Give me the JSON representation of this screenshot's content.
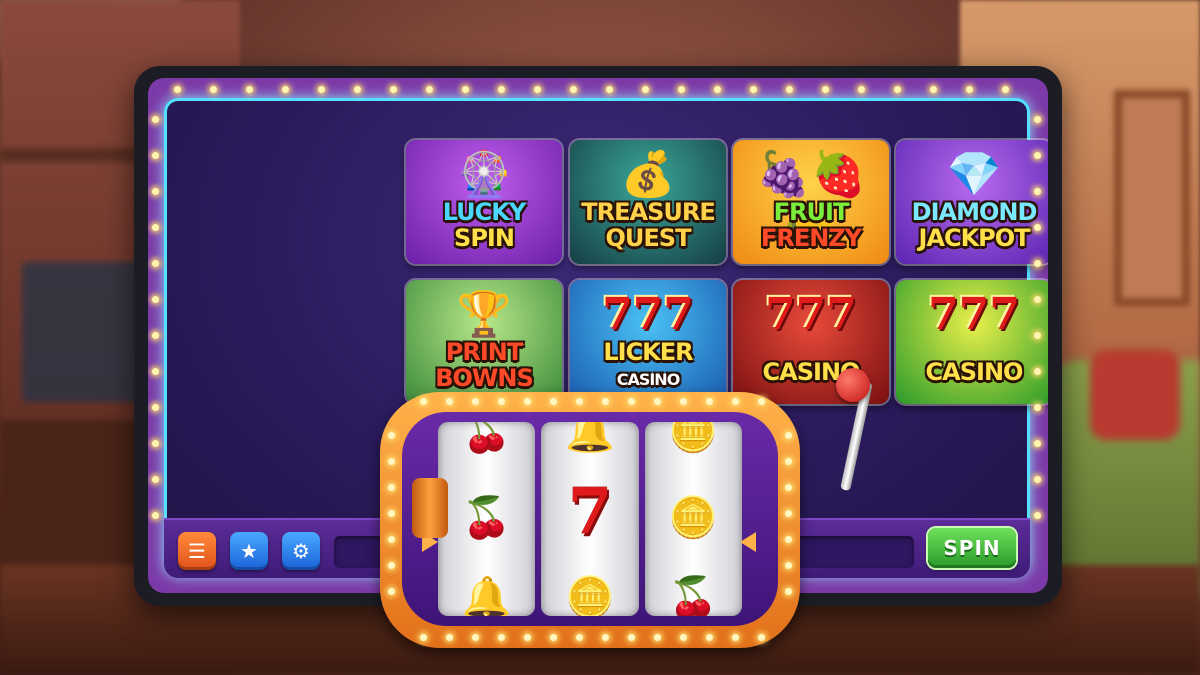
{
  "games": [
    {
      "title1": "LUCKY",
      "title2": "SPIN",
      "art": "🎡",
      "bg": "bg-purple",
      "c1": "#4ad8ff",
      "c2": "#ffe04a"
    },
    {
      "title1": "TREASURE",
      "title2": "QUEST",
      "art": "💰",
      "bg": "bg-teal",
      "c1": "#ffd24a",
      "c2": "#ffd24a"
    },
    {
      "title1": "FRUIT",
      "title2": "FRENZY",
      "art": "🍇🍓🍋",
      "bg": "bg-orange",
      "c1": "#7aee3a",
      "c2": "#ff4a2a"
    },
    {
      "title1": "DIAMOND",
      "title2": "JACKPOT",
      "art": "💎",
      "bg": "bg-violet",
      "c1": "#7ae8ff",
      "c2": "#ffe04a"
    },
    {
      "title1": "PRINT",
      "title2": "BOWNS",
      "art": "🏆",
      "bg": "bg-green",
      "c1": "#ff4a2a",
      "c2": "#ff4a2a"
    },
    {
      "title1": "LICKER",
      "title2": "CASINO",
      "art": "777",
      "bg": "bg-blue",
      "c1": "#ffe04a",
      "c2": "#ffffff"
    },
    {
      "title1": "CASINO",
      "title2": "",
      "art": "777",
      "bg": "bg-red",
      "c1": "#ffe04a",
      "c2": "#ffe04a"
    },
    {
      "title1": "CASINO",
      "title2": "",
      "art": "777",
      "bg": "bg-lime",
      "c1": "#ffe04a",
      "c2": "#ffe04a"
    }
  ],
  "toolbar": {
    "menu_icon": "list-icon",
    "favorites_icon": "star-icon",
    "settings_icon": "gear-icon",
    "spin_label": "SPIN"
  },
  "slot_machine": {
    "reels": [
      {
        "symbols": [
          "🍒",
          "🍒",
          "🔔"
        ],
        "names": [
          "cherry",
          "cherry",
          "bell"
        ]
      },
      {
        "symbols": [
          "🔔",
          "7",
          "🪙"
        ],
        "names": [
          "bell",
          "seven",
          "coin"
        ]
      },
      {
        "symbols": [
          "🪙",
          "🪙",
          "🍒"
        ],
        "names": [
          "coin",
          "coin",
          "cherry"
        ]
      }
    ]
  }
}
